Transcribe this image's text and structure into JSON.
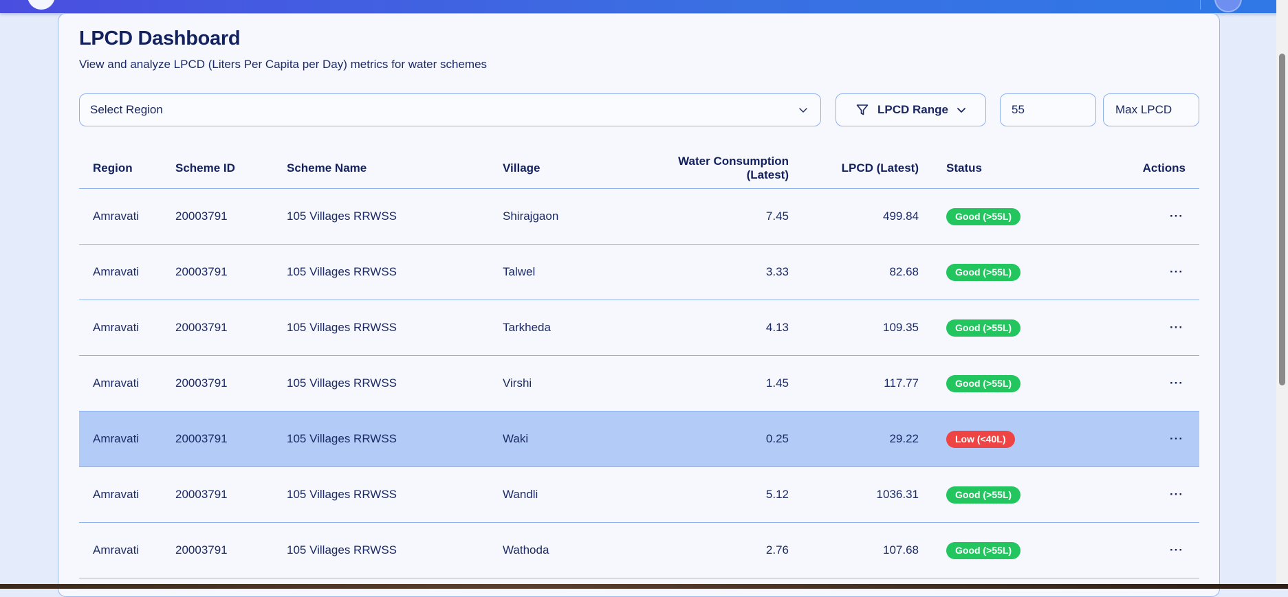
{
  "header": {
    "title": "LPCD Dashboard",
    "subtitle": "View and analyze LPCD (Liters Per Capita per Day) metrics for water schemes"
  },
  "filters": {
    "region_placeholder": "Select Region",
    "lpcd_range_label": "LPCD Range",
    "min_value": "55",
    "max_placeholder": "Max LPCD"
  },
  "table": {
    "columns": {
      "region": "Region",
      "scheme_id": "Scheme ID",
      "scheme_name": "Scheme Name",
      "village": "Village",
      "consumption": "Water Consumption (Latest)",
      "lpcd": "LPCD (Latest)",
      "status": "Status",
      "actions": "Actions"
    },
    "rows": [
      {
        "region": "Amravati",
        "scheme_id": "20003791",
        "scheme_name": "105 Villages RRWSS",
        "village": "Shirajgaon",
        "consumption": "7.45",
        "lpcd": "499.84",
        "status": "Good (>55L)",
        "actions": "···"
      },
      {
        "region": "Amravati",
        "scheme_id": "20003791",
        "scheme_name": "105 Villages RRWSS",
        "village": "Talwel",
        "consumption": "3.33",
        "lpcd": "82.68",
        "status": "Good (>55L)",
        "actions": "···"
      },
      {
        "region": "Amravati",
        "scheme_id": "20003791",
        "scheme_name": "105 Villages RRWSS",
        "village": "Tarkheda",
        "consumption": "4.13",
        "lpcd": "109.35",
        "status": "Good (>55L)",
        "actions": "···"
      },
      {
        "region": "Amravati",
        "scheme_id": "20003791",
        "scheme_name": "105 Villages RRWSS",
        "village": "Virshi",
        "consumption": "1.45",
        "lpcd": "117.77",
        "status": "Good (>55L)",
        "actions": "···"
      },
      {
        "region": "Amravati",
        "scheme_id": "20003791",
        "scheme_name": "105 Villages RRWSS",
        "village": "Waki",
        "consumption": "0.25",
        "lpcd": "29.22",
        "status": "Low (<40L)",
        "actions": "···"
      },
      {
        "region": "Amravati",
        "scheme_id": "20003791",
        "scheme_name": "105 Villages RRWSS",
        "village": "Wandli",
        "consumption": "5.12",
        "lpcd": "1036.31",
        "status": "Good (>55L)",
        "actions": "···"
      },
      {
        "region": "Amravati",
        "scheme_id": "20003791",
        "scheme_name": "105 Villages RRWSS",
        "village": "Wathoda",
        "consumption": "2.76",
        "lpcd": "107.68",
        "status": "Good (>55L)",
        "actions": "···"
      }
    ]
  },
  "colors": {
    "status_good": "#22c55e",
    "status_low": "#ef4444",
    "selected_row": "#b3cbf7",
    "accent": "#3a6fe2"
  }
}
